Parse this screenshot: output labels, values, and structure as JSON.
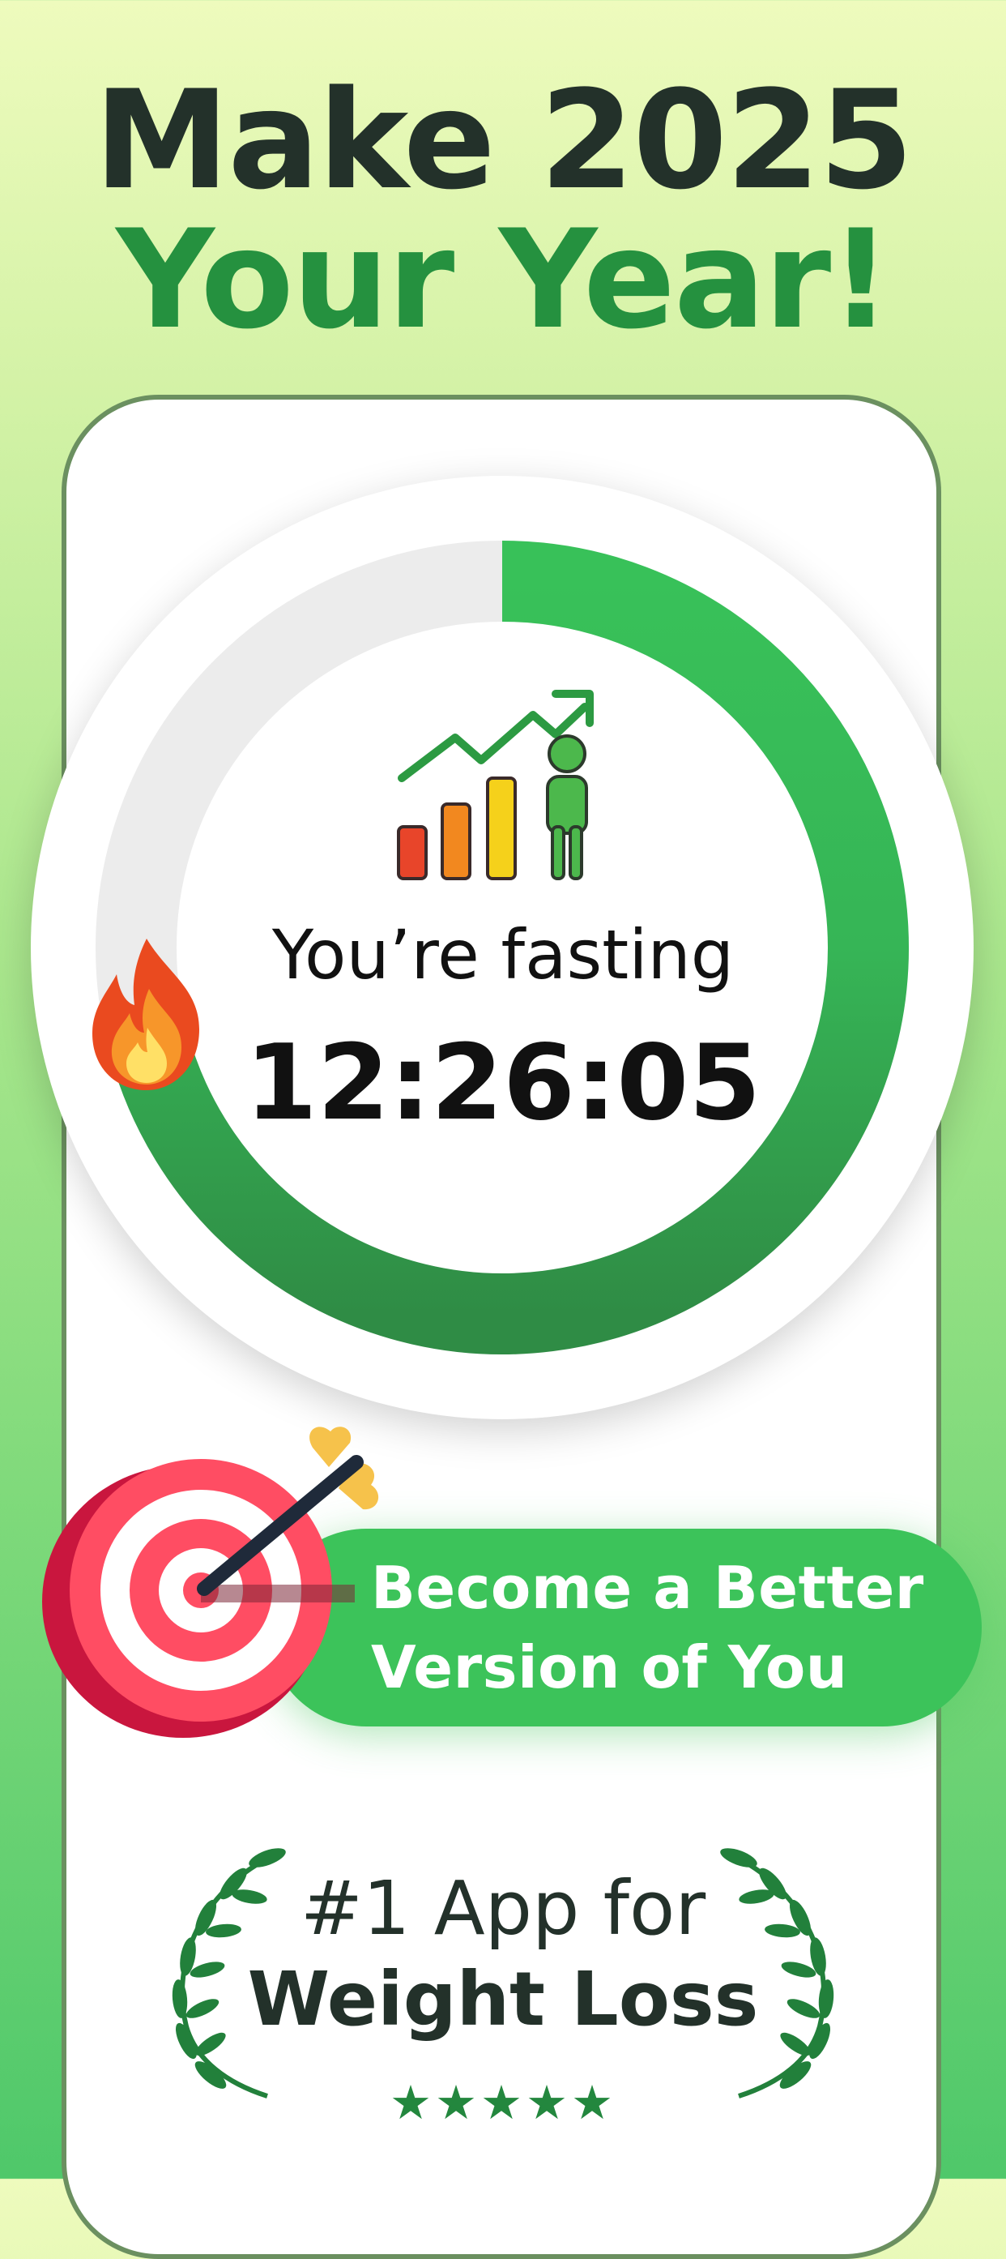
{
  "headline": {
    "line1": "Make 2025",
    "line2": "Your Year!"
  },
  "tracker": {
    "status": "You’re fasting",
    "timer": "12:26:05",
    "progress": 0.72,
    "icons": [
      "growth-chart-icon",
      "fire-icon"
    ]
  },
  "feature_pill": {
    "line1": "Become a Better",
    "line2": "Version of You",
    "icon": "target-arrow-icon"
  },
  "award": {
    "line1": "#1 App for",
    "line2": "Weight Loss",
    "stars": "★★★★★",
    "rating": 5
  },
  "colors": {
    "headline_dark": "#23312a",
    "headline_green": "#25913f",
    "ring_green": "#38c159",
    "ring_dark_green": "#2f8c45",
    "ring_track": "#ececec",
    "pill_green": "#3cc35a"
  }
}
